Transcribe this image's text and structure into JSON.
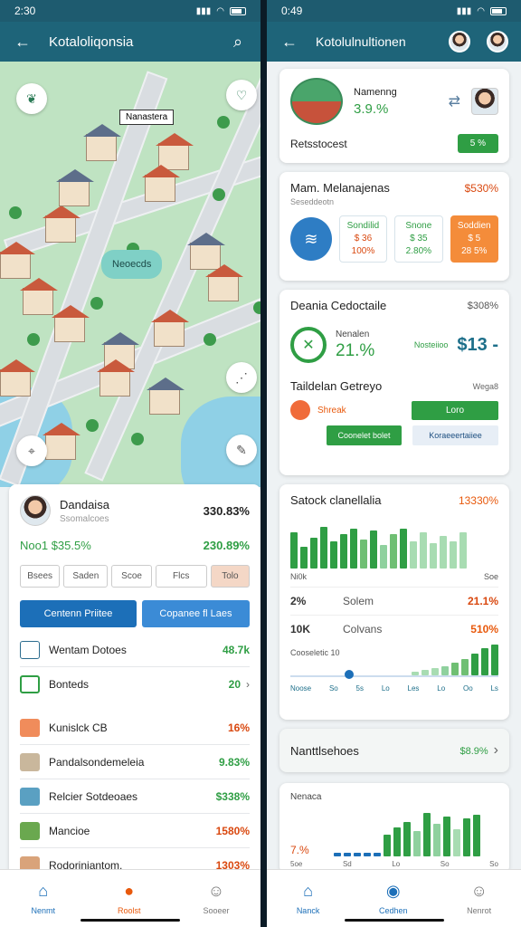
{
  "left": {
    "status_time": "2:30",
    "title": "Kotaloliqonsia",
    "map": {
      "tag": "Nanastera",
      "bubble": "Neoecds"
    },
    "summary": {
      "name": "Dandaisa",
      "subtitle": "Ssomalcoes",
      "amount": "330.83%",
      "line_left": "Noo1 $35.5%",
      "line_right": "230.89%",
      "chips": [
        "Bsees",
        "Saden",
        "Scoe",
        "Flcs",
        "Tolo"
      ],
      "btn_primary": "Centenn Priitee",
      "btn_secondary": "Copanee fl Laes",
      "rows": [
        {
          "label": "Wentam Dotoes",
          "value": "48.7k"
        },
        {
          "label": "Bonteds",
          "value": "20",
          "chevron": "›"
        },
        {
          "label": "Kunislck CB",
          "value": "16%"
        },
        {
          "label": "Pandalsondemeleia",
          "value": "9.83%"
        },
        {
          "label": "Relcier Sotdeoaes",
          "value": "$338%"
        },
        {
          "label": "Mancioe",
          "value": "1580%"
        },
        {
          "label": "Rodorjniantom.",
          "value": "1303%"
        }
      ]
    },
    "nav": [
      {
        "label": "Nenmt"
      },
      {
        "label": "Roolst"
      },
      {
        "label": "Sooeer"
      }
    ]
  },
  "right": {
    "status_time": "0:49",
    "title": "Kotolulnultionen",
    "top_card": {
      "name": "Namenng",
      "pct": "3.9.%",
      "label": "Retsstocest",
      "badge": "5 %"
    },
    "card2": {
      "title": "Mam. Melanajenas",
      "subtitle": "Seseddeotn",
      "value": "$530%",
      "boxes": [
        {
          "l1": "Sondilid",
          "l2": "$ 36",
          "l3": "100%"
        },
        {
          "l1": "Snone",
          "l2": "$ 35",
          "l3": "2.80%"
        },
        {
          "l1": "Soddien",
          "l2": "$ 5",
          "l3": "28 5%"
        }
      ]
    },
    "card3": {
      "title": "Deania Cedoctaile",
      "value": "$308%",
      "metric_label": "Nenalen",
      "metric_pct": "21.%",
      "small_label": "Nosteiioo",
      "big_number": "$13 -",
      "sub_title": "Taildelan Getreyo",
      "sub_value": "Wega8",
      "tag_label": "Shreak",
      "btn_green": "Loro",
      "btn_green2": "Coonelet bolet",
      "btn_light": "Koraeeertaiiee"
    },
    "card4": {
      "title": "Satock clanellalia",
      "value": "13330%",
      "axis_left": "Ni",
      "axis_mid": "0k",
      "axis_right": "Soe",
      "rows": [
        {
          "a": "2%",
          "b": "Solem",
          "c": "21.1%"
        },
        {
          "a": "10K",
          "b": "Colvans",
          "c": "510%"
        }
      ],
      "slider_label": "Cooseletic 10",
      "ticks": [
        "Noose",
        "So",
        "5s",
        "Lo",
        "Les",
        "Lo",
        "Oo",
        "Ls"
      ]
    },
    "card5": {
      "title": "Nanttlsehoes",
      "value": "$8.9%"
    },
    "card6": {
      "title": "Nenaca",
      "pct": "7.%",
      "ticks": [
        "5oe",
        "Sd",
        "Lo",
        "So",
        "So"
      ]
    },
    "nav": [
      {
        "label": "Nanck"
      },
      {
        "label": "Cedhen"
      },
      {
        "label": "Nenrot"
      }
    ]
  }
}
